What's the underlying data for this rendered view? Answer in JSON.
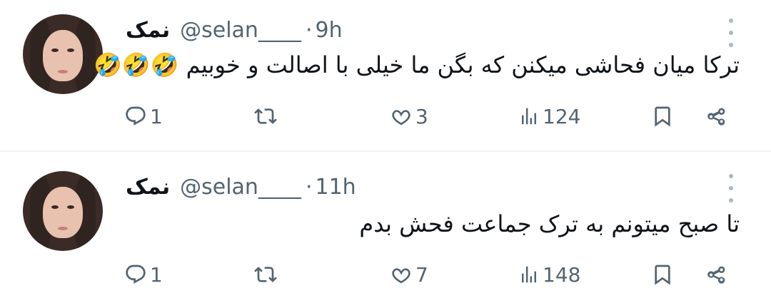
{
  "tweets": [
    {
      "name": "نمک",
      "handle": "@selan____",
      "separator": "·",
      "time": "9h",
      "text": "ترکا میان فحاشی میکنن که بگن ما خیلی با اصالت و خوبیم 🤣🤣🤣",
      "replies": "1",
      "retweets": "",
      "likes": "3",
      "views": "124",
      "icons": [
        "reply-icon",
        "retweet-icon",
        "like-icon",
        "views-icon",
        "bookmark-icon",
        "share-icon"
      ]
    },
    {
      "name": "نمک",
      "handle": "@selan____",
      "separator": "·",
      "time": "11h",
      "text": "تا صبح میتونم به ترک جماعت فحش بدم",
      "replies": "1",
      "retweets": "",
      "likes": "7",
      "views": "148",
      "icons": [
        "reply-icon",
        "retweet-icon",
        "like-icon",
        "views-icon",
        "bookmark-icon",
        "share-icon"
      ]
    }
  ],
  "colors": {
    "text": "#0f1419",
    "secondary": "#536471",
    "divider": "#eff3f4"
  }
}
